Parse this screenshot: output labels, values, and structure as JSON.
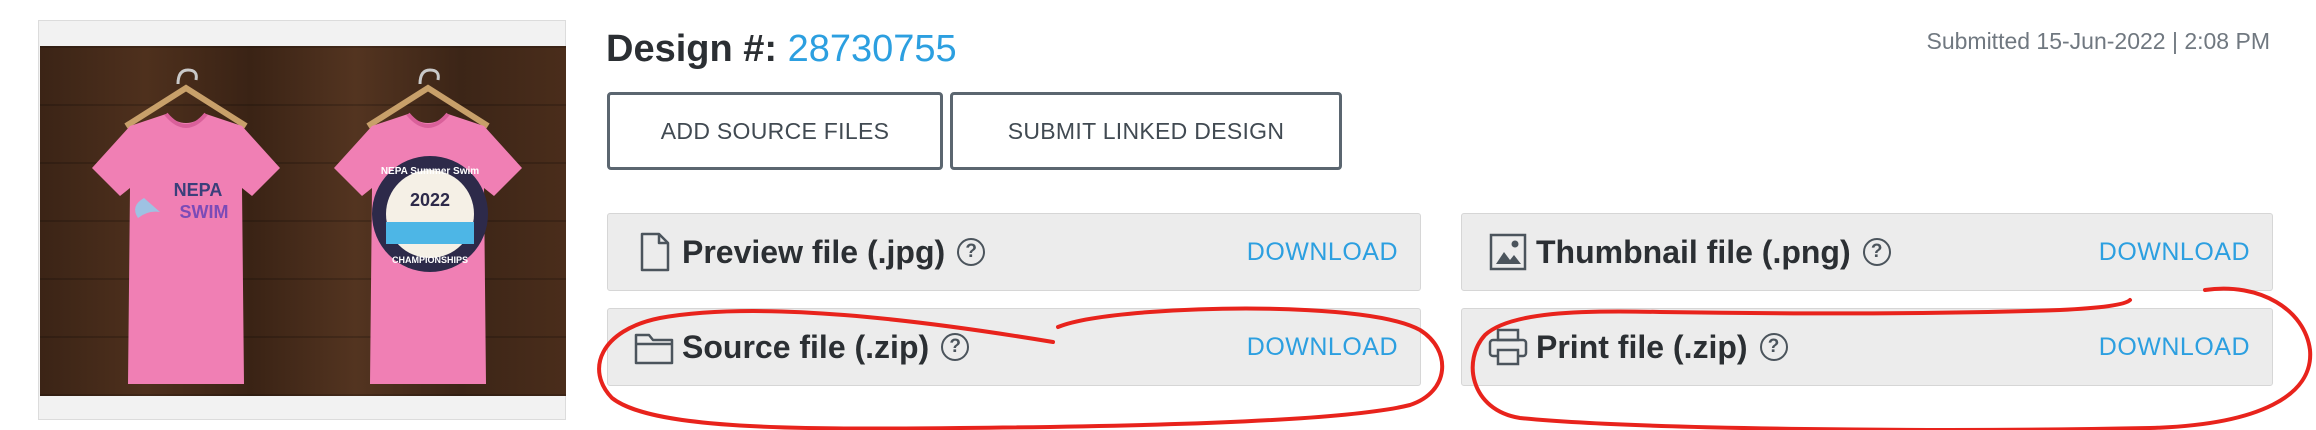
{
  "header": {
    "design_label": "Design #:",
    "design_number": "28730755",
    "submitted": "Submitted 15-Jun-2022 | 2:08 PM"
  },
  "actions": {
    "add_source_files": "ADD SOURCE FILES",
    "submit_linked_design": "SUBMIT LINKED DESIGN"
  },
  "files": {
    "preview": {
      "label": "Preview file (.jpg)",
      "download": "DOWNLOAD",
      "icon": "document-icon"
    },
    "thumbnail": {
      "label": "Thumbnail file (.png)",
      "download": "DOWNLOAD",
      "icon": "image-icon"
    },
    "source": {
      "label": "Source file (.zip)",
      "download": "DOWNLOAD",
      "icon": "folder-icon"
    },
    "print": {
      "label": "Print file (.zip)",
      "download": "DOWNLOAD",
      "icon": "printer-icon"
    }
  },
  "help_glyph": "?",
  "mockup": {
    "left_shirt": {
      "line1": "NEPA",
      "line2": "SWIM"
    },
    "right_shirt": {
      "arc_top": "NEPA Summer Swim",
      "year": "2022",
      "arc_bottom": "CHAMPIONSHIPS"
    }
  },
  "colors": {
    "accent": "#2c9fe0",
    "shirt_pink": "#f07fb4",
    "annotation_red": "#e8231c",
    "row_background": "#ececec"
  }
}
